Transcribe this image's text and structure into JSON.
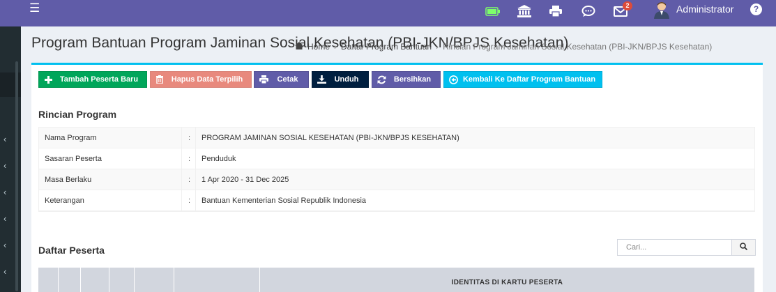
{
  "header": {
    "menu_icon": "hamburger-icon",
    "icons": [
      "battery-icon",
      "bank-icon",
      "printer-icon",
      "chat-icon",
      "mail-icon"
    ],
    "mail_badge": "2",
    "user_name": "Administrator",
    "help_label": "?"
  },
  "page": {
    "title": "Program Bantuan Program Jaminan Sosial Kesehatan (PBI-JKN/BPJS Kesehatan)"
  },
  "breadcrumb": {
    "home": "Home",
    "list": "Daftar Program Bantuan",
    "current": "Rincian Program Jaminan Sosial Kesehatan (PBI-JKN/BPJS Kesehatan)"
  },
  "toolbar": {
    "add": "Tambah Peserta Baru",
    "delete": "Hapus Data Terpilih",
    "print": "Cetak",
    "download": "Unduh",
    "clear": "Bersihkan",
    "back": "Kembali Ke Daftar Program Bantuan"
  },
  "colors": {
    "header": "#605ca8",
    "add": "#00a65a",
    "delete": "#dd4b39",
    "print": "#605ca8",
    "download": "#001f3f",
    "clear": "#605ca8",
    "back": "#00c0ef",
    "box_border": "#00c0ef"
  },
  "details": {
    "title": "Rincian Program",
    "rows": [
      {
        "key": "Nama Program",
        "sep": ":",
        "value": "PROGRAM JAMINAN SOSIAL KESEHATAN (PBI-JKN/BPJS KESEHATAN)"
      },
      {
        "key": "Sasaran Peserta",
        "sep": ":",
        "value": "Penduduk"
      },
      {
        "key": "Masa Berlaku",
        "sep": ":",
        "value": "1 Apr 2020 - 31 Dec 2025"
      },
      {
        "key": "Keterangan",
        "sep": ":",
        "value": "Bantuan Kementerian Sosial Republik Indonesia"
      }
    ]
  },
  "peserta": {
    "title": "Daftar Peserta",
    "search_placeholder": "Cari...",
    "group_header": "IDENTITAS DI KARTU PESERTA"
  }
}
